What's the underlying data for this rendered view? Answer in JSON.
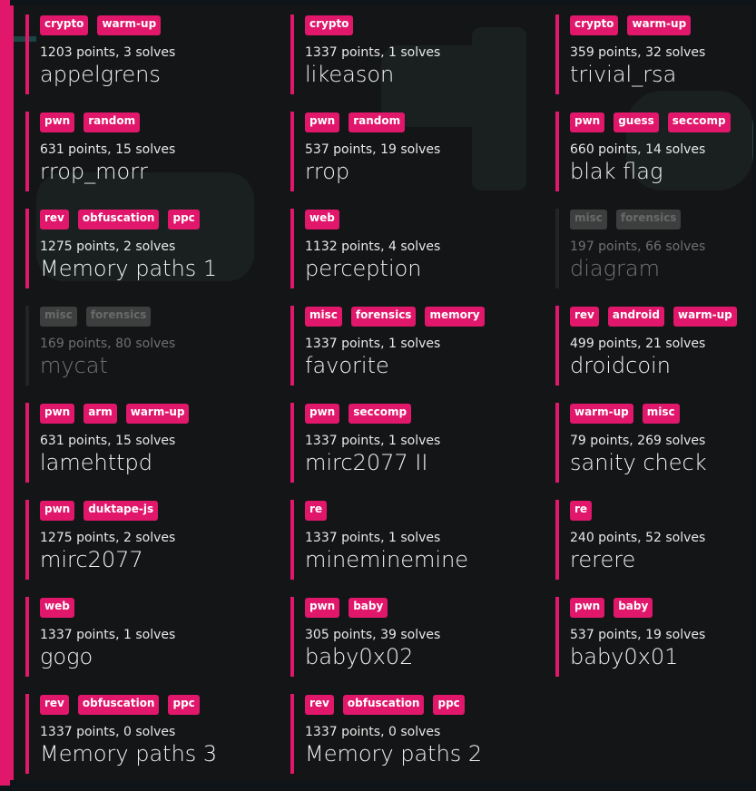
{
  "colors": {
    "accent": "#e0176b",
    "solved_border": "#3a3a3a",
    "tag_solved": "#777777"
  },
  "challenges": [
    {
      "tags": [
        "crypto",
        "warm-up"
      ],
      "meta": "1203 points, 3 solves",
      "name": "appelgrens",
      "solved": false
    },
    {
      "tags": [
        "crypto"
      ],
      "meta": "1337 points, 1 solves",
      "name": "likeason",
      "solved": false
    },
    {
      "tags": [
        "crypto",
        "warm-up"
      ],
      "meta": "359 points, 32 solves",
      "name": "trivial_rsa",
      "solved": false
    },
    {
      "tags": [
        "pwn",
        "random"
      ],
      "meta": "631 points, 15 solves",
      "name": "rrop_morr",
      "solved": false
    },
    {
      "tags": [
        "pwn",
        "random"
      ],
      "meta": "537 points, 19 solves",
      "name": "rrop",
      "solved": false
    },
    {
      "tags": [
        "pwn",
        "guess",
        "seccomp"
      ],
      "meta": "660 points, 14 solves",
      "name": "blak flag",
      "solved": false
    },
    {
      "tags": [
        "rev",
        "obfuscation",
        "ppc"
      ],
      "meta": "1275 points, 2 solves",
      "name": "Memory paths 1",
      "solved": false
    },
    {
      "tags": [
        "web"
      ],
      "meta": "1132 points, 4 solves",
      "name": "perception",
      "solved": false
    },
    {
      "tags": [
        "misc",
        "forensics"
      ],
      "meta": "197 points, 66 solves",
      "name": "diagram",
      "solved": true
    },
    {
      "tags": [
        "misc",
        "forensics"
      ],
      "meta": "169 points, 80 solves",
      "name": "mycat",
      "solved": true
    },
    {
      "tags": [
        "misc",
        "forensics",
        "memory"
      ],
      "meta": "1337 points, 1 solves",
      "name": "favorite",
      "solved": false
    },
    {
      "tags": [
        "rev",
        "android",
        "warm-up"
      ],
      "meta": "499 points, 21 solves",
      "name": "droidcoin",
      "solved": false
    },
    {
      "tags": [
        "pwn",
        "arm",
        "warm-up"
      ],
      "meta": "631 points, 15 solves",
      "name": "lamehttpd",
      "solved": false
    },
    {
      "tags": [
        "pwn",
        "seccomp"
      ],
      "meta": "1337 points, 1 solves",
      "name": "mirc2077 II",
      "solved": false
    },
    {
      "tags": [
        "warm-up",
        "misc"
      ],
      "meta": "79 points, 269 solves",
      "name": "sanity check",
      "solved": false
    },
    {
      "tags": [
        "pwn",
        "duktape-js"
      ],
      "meta": "1275 points, 2 solves",
      "name": "mirc2077",
      "solved": false
    },
    {
      "tags": [
        "re"
      ],
      "meta": "1337 points, 1 solves",
      "name": "mineminemine",
      "solved": false
    },
    {
      "tags": [
        "re"
      ],
      "meta": "240 points, 52 solves",
      "name": "rerere",
      "solved": false
    },
    {
      "tags": [
        "web"
      ],
      "meta": "1337 points, 1 solves",
      "name": "gogo",
      "solved": false
    },
    {
      "tags": [
        "pwn",
        "baby"
      ],
      "meta": "305 points, 39 solves",
      "name": "baby0x02",
      "solved": false
    },
    {
      "tags": [
        "pwn",
        "baby"
      ],
      "meta": "537 points, 19 solves",
      "name": "baby0x01",
      "solved": false
    },
    {
      "tags": [
        "rev",
        "obfuscation",
        "ppc"
      ],
      "meta": "1337 points, 0 solves",
      "name": "Memory paths 3",
      "solved": false
    },
    {
      "tags": [
        "rev",
        "obfuscation",
        "ppc"
      ],
      "meta": "1337 points, 0 solves",
      "name": "Memory paths 2",
      "solved": false
    }
  ]
}
